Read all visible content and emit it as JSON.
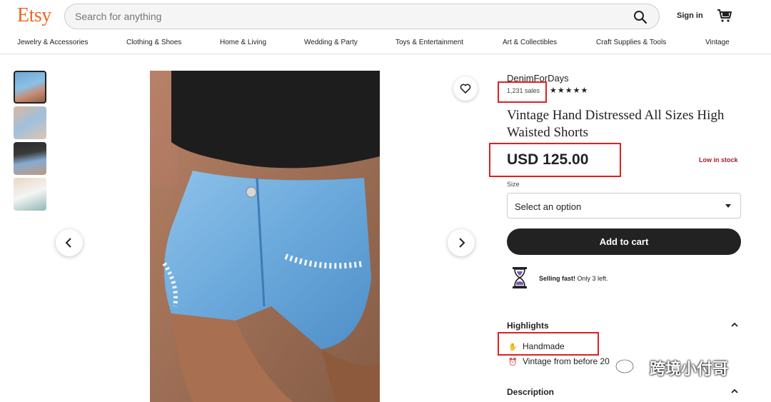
{
  "header": {
    "logo": "Etsy",
    "search_placeholder": "Search for anything",
    "signin_label": "Sign in"
  },
  "nav": [
    "Jewelry & Accessories",
    "Clothing & Shoes",
    "Home & Living",
    "Wedding & Party",
    "Toys & Entertainment",
    "Art & Collectibles",
    "Craft Supplies & Tools",
    "Vintage"
  ],
  "listing": {
    "shop_name": "DenimForDays",
    "sales": "1,231 sales",
    "rating_stars": "★★★★★",
    "title": "Vintage Hand Distressed All Sizes High Waisted Shorts",
    "price": "USD 125.00",
    "stock_status": "Low in stock",
    "size_label": "Size",
    "size_selected": "Select an option",
    "add_to_cart": "Add to cart",
    "selling_fast_bold": "Selling fast!",
    "selling_fast_rest": "Only 3 left."
  },
  "highlights": {
    "heading": "Highlights",
    "items": [
      "Handmade",
      "Vintage from before 20"
    ]
  },
  "description": {
    "heading": "Description"
  },
  "watermark": "跨境小付哥",
  "colors": {
    "brand": "#F1641E",
    "stock": "#A61A2E",
    "annotation": "#E02020"
  }
}
